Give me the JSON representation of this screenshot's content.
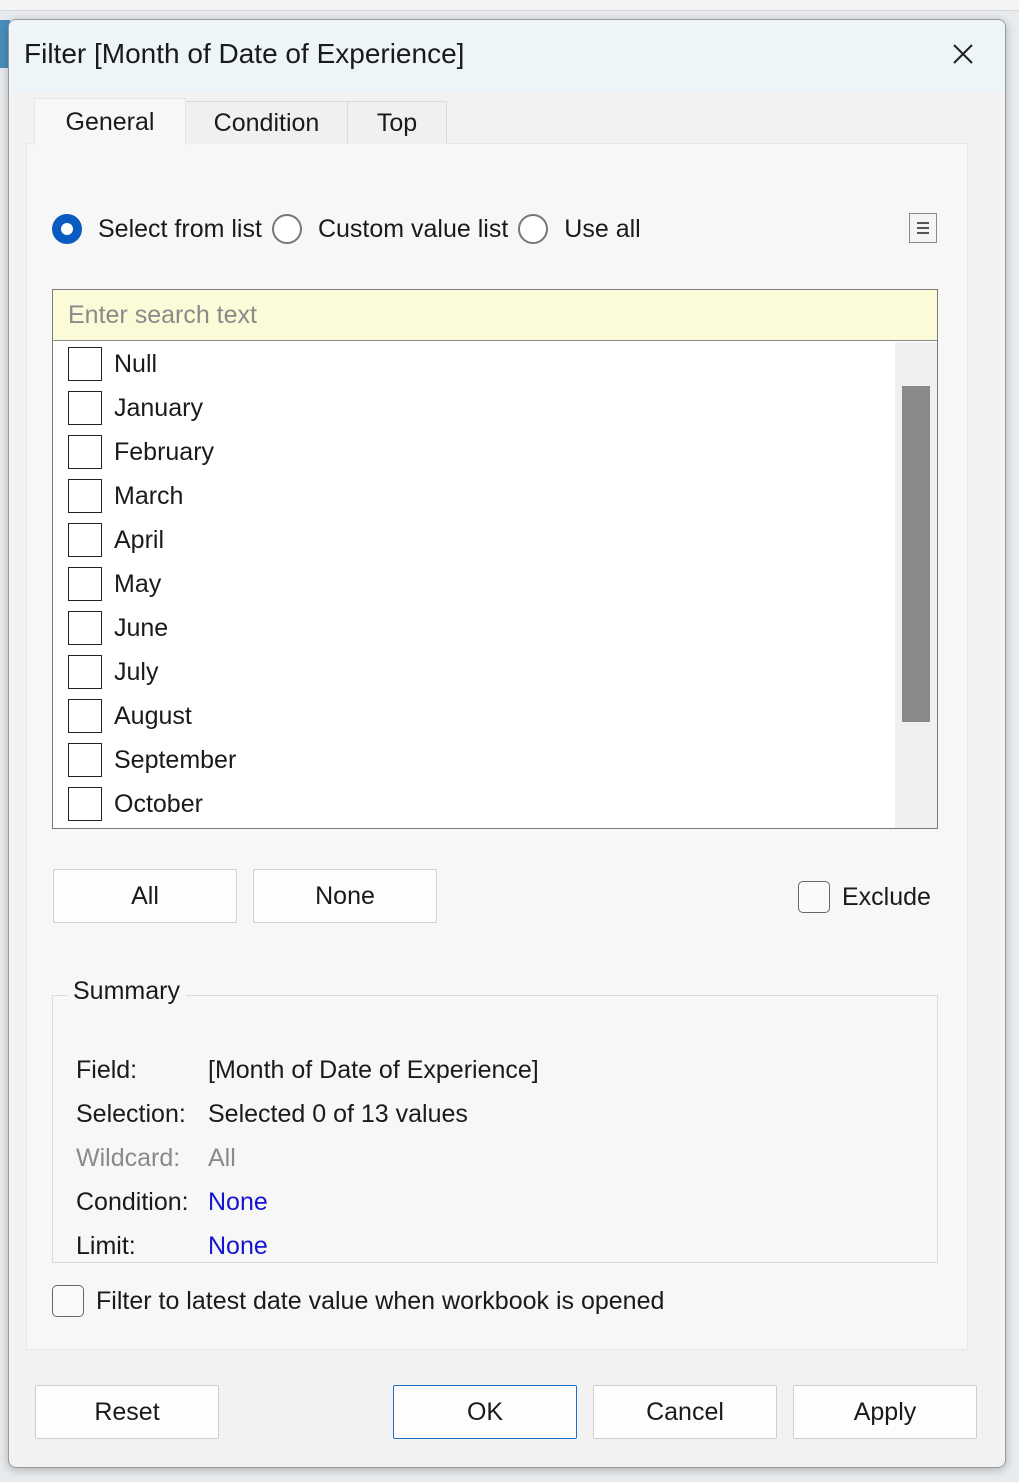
{
  "dialog": {
    "title": "Filter [Month of Date of Experience]"
  },
  "tabs": [
    {
      "label": "General",
      "active": true
    },
    {
      "label": "Condition",
      "active": false
    },
    {
      "label": "Top",
      "active": false
    }
  ],
  "mode": {
    "options": [
      {
        "label": "Select from list",
        "selected": true
      },
      {
        "label": "Custom value list",
        "selected": false
      },
      {
        "label": "Use all",
        "selected": false
      }
    ]
  },
  "search": {
    "placeholder": "Enter search text",
    "value": ""
  },
  "values": [
    {
      "label": "Null",
      "checked": false
    },
    {
      "label": "January",
      "checked": false
    },
    {
      "label": "February",
      "checked": false
    },
    {
      "label": "March",
      "checked": false
    },
    {
      "label": "April",
      "checked": false
    },
    {
      "label": "May",
      "checked": false
    },
    {
      "label": "June",
      "checked": false
    },
    {
      "label": "July",
      "checked": false
    },
    {
      "label": "August",
      "checked": false
    },
    {
      "label": "September",
      "checked": false
    },
    {
      "label": "October",
      "checked": false
    }
  ],
  "list_buttons": {
    "all": "All",
    "none": "None"
  },
  "exclude": {
    "label": "Exclude",
    "checked": false
  },
  "summary": {
    "title": "Summary",
    "rows": [
      {
        "label": "Field:",
        "value": "[Month of Date of Experience]"
      },
      {
        "label": "Selection:",
        "value": "Selected 0 of 13 values"
      },
      {
        "label": "Wildcard:",
        "value": "All"
      },
      {
        "label": "Condition:",
        "value": "None"
      },
      {
        "label": "Limit:",
        "value": "None"
      }
    ]
  },
  "latest_date": {
    "label": "Filter to latest date value when workbook is opened",
    "checked": false
  },
  "footer": {
    "reset": "Reset",
    "ok": "OK",
    "cancel": "Cancel",
    "apply": "Apply"
  },
  "colors": {
    "accent": "#0a5bbf",
    "link": "#1515d0",
    "search_bg": "#fbfbd8",
    "disabled_text": "#8a8a8a"
  }
}
